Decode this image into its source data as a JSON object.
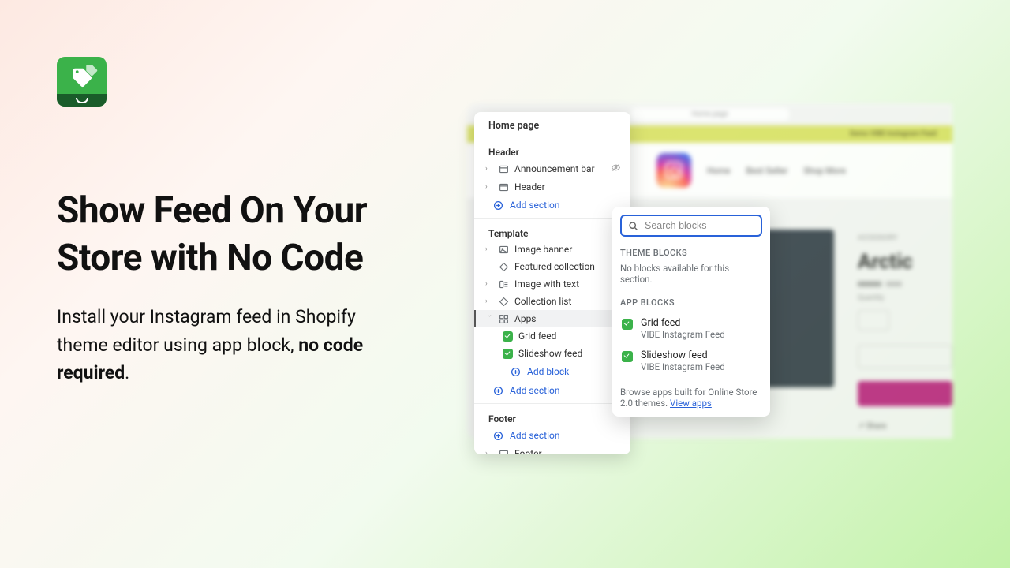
{
  "marketing": {
    "headline": "Show Feed On Your Store with No Code",
    "sub_before": "Install your Instagram feed in Shopify theme editor using app block, ",
    "sub_bold": "no code required",
    "sub_after": "."
  },
  "backdrop": {
    "url_hint": "Home page",
    "banner": "Demo VIBE Instagram Feed",
    "nav": [
      "Home",
      "Best Seller",
      "Shop More"
    ],
    "eyebrow": "ACCESSORY",
    "title": "Arctic",
    "share": "Share"
  },
  "panel": {
    "title": "Home page",
    "groups": {
      "header": {
        "label": "Header",
        "rows": [
          {
            "label": "Announcement bar",
            "chevron": true,
            "hide": true
          },
          {
            "label": "Header",
            "chevron": true
          }
        ],
        "add": "Add section"
      },
      "template": {
        "label": "Template",
        "rows": [
          {
            "label": "Image banner",
            "chevron": true
          },
          {
            "label": "Featured collection"
          },
          {
            "label": "Image with text",
            "chevron": true
          },
          {
            "label": "Collection list",
            "chevron": true
          },
          {
            "label": "Apps",
            "chevron": true,
            "expanded": true,
            "hl": true
          }
        ],
        "children": [
          {
            "label": "Grid feed"
          },
          {
            "label": "Slideshow feed"
          }
        ],
        "add_block": "Add block",
        "add": "Add section"
      },
      "footer": {
        "label": "Footer",
        "add": "Add section",
        "rows": [
          {
            "label": "Footer",
            "chevron": true
          }
        ]
      }
    }
  },
  "popover": {
    "search_placeholder": "Search blocks",
    "theme_blocks_hdr": "THEME BLOCKS",
    "none": "No blocks available for this section.",
    "app_blocks_hdr": "APP BLOCKS",
    "items": [
      {
        "name": "Grid feed",
        "sub": "VIBE Instagram Feed"
      },
      {
        "name": "Slideshow feed",
        "sub": "VIBE Instagram Feed"
      }
    ],
    "foot_text": "Browse apps built for Online Store 2.0 themes. ",
    "foot_link": "View apps"
  }
}
